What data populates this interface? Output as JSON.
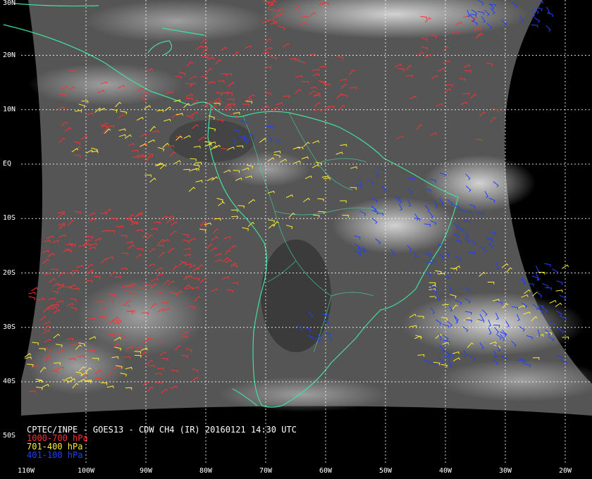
{
  "caption": {
    "title": "CPTEC/INPE - GOES13 - CDW CH4 (IR) 20160121 14:30 UTC",
    "legend": [
      {
        "label": "1000-700 hPa",
        "color": "#ff3030"
      },
      {
        "label": "701-400 hPa",
        "color": "#ffee33"
      },
      {
        "label": "401-100 hPa",
        "color": "#2040ff"
      }
    ]
  },
  "lat_labels": [
    {
      "text": "30N",
      "lat": 30
    },
    {
      "text": "20N",
      "lat": 20
    },
    {
      "text": "10N",
      "lat": 10
    },
    {
      "text": "EQ",
      "lat": 0
    },
    {
      "text": "10S",
      "lat": -10
    },
    {
      "text": "20S",
      "lat": -20
    },
    {
      "text": "30S",
      "lat": -30
    },
    {
      "text": "40S",
      "lat": -40
    },
    {
      "text": "50S",
      "lat": -50
    }
  ],
  "lon_labels": [
    {
      "text": "110W",
      "lon": -110
    },
    {
      "text": "100W",
      "lon": -100
    },
    {
      "text": "90W",
      "lon": -90
    },
    {
      "text": "80W",
      "lon": -80
    },
    {
      "text": "70W",
      "lon": -70
    },
    {
      "text": "60W",
      "lon": -60
    },
    {
      "text": "50W",
      "lon": -50
    },
    {
      "text": "40W",
      "lon": -40
    },
    {
      "text": "30W",
      "lon": -30
    },
    {
      "text": "20W",
      "lon": -20
    }
  ],
  "colors": {
    "coastline": "#40e0a0",
    "grid": "#ffffff",
    "low_level": "#ff3030",
    "mid_level": "#ffee33",
    "high_level": "#2040ff"
  }
}
